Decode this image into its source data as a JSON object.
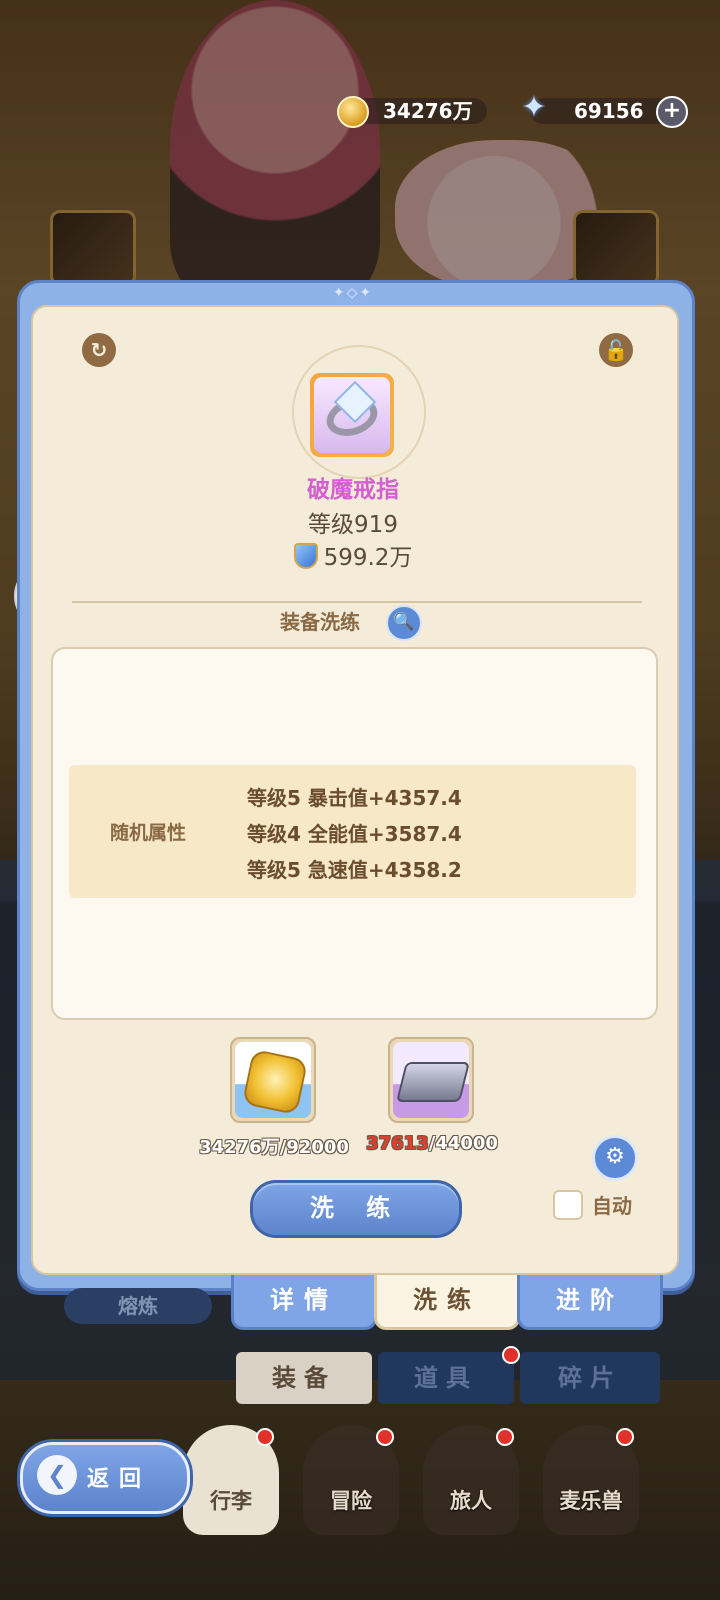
{
  "currency": {
    "gold": "34276万",
    "gems": "69156",
    "gold_icon": "gold-coin-icon",
    "gem_icon": "crystal-star-icon",
    "add_icon": "plus-icon"
  },
  "item": {
    "name": "破魔戒指",
    "level": "等级919",
    "power": "599.2万",
    "name_color": "#d45fd0"
  },
  "section": {
    "title": "装备洗练"
  },
  "attributes": {
    "label": "随机属性",
    "lines": [
      "等级5  暴击值+4357.4",
      "等级4  全能值+3587.4",
      "等级5  急速值+4358.2"
    ]
  },
  "costs": [
    {
      "current": "34276万",
      "required": "/92000",
      "insufficient": false
    },
    {
      "current": "37613",
      "required": "/44000",
      "insufficient": true
    }
  ],
  "actions": {
    "refine": "洗 练",
    "auto": "自动"
  },
  "tabs": [
    {
      "label": "详情",
      "active": false
    },
    {
      "label": "洗练",
      "active": true
    },
    {
      "label": "进阶",
      "active": false
    }
  ],
  "smelt": "熔炼",
  "categories": [
    {
      "label": "装备",
      "active": true
    },
    {
      "label": "道具",
      "active": false
    },
    {
      "label": "碎片",
      "active": false
    }
  ],
  "nav": {
    "back": "返回",
    "items": [
      "行李",
      "冒险",
      "旅人",
      "麦乐兽"
    ]
  },
  "colors": {
    "panel_blue": "#8fb2e6",
    "panel_cream": "#f4ecd9",
    "accent_blue": "#5d84cc",
    "insufficient_red": "#e33d2e"
  }
}
